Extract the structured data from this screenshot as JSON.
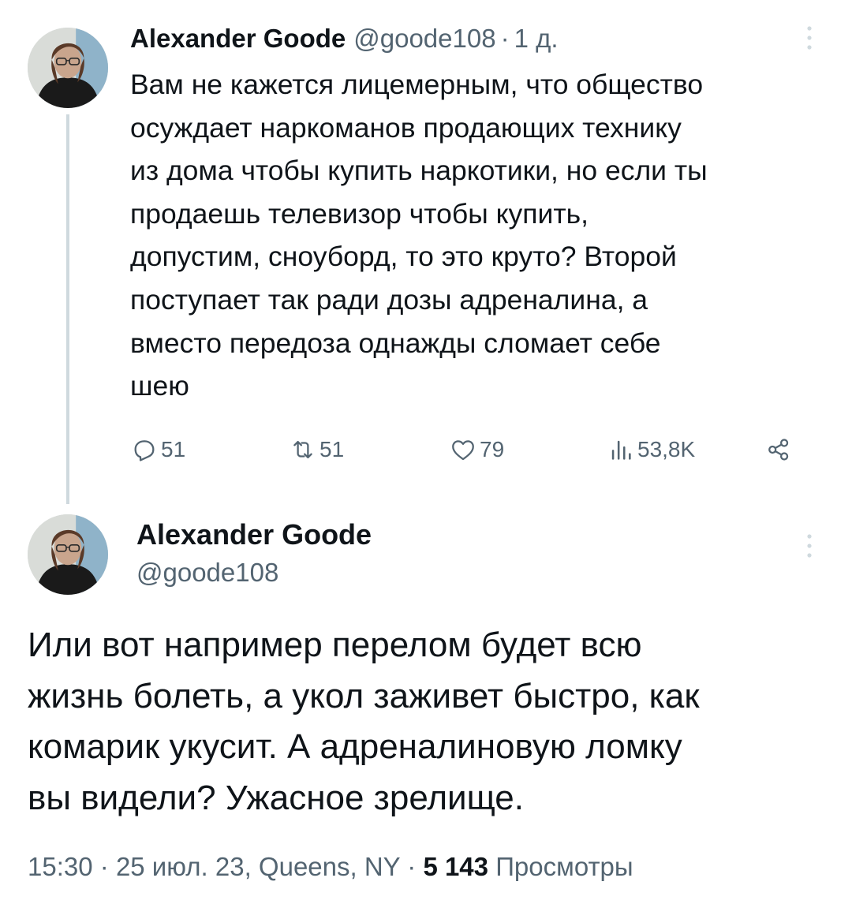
{
  "reply_tweet": {
    "author_name": "Alexander Goode",
    "handle": "@goode108",
    "separator": "·",
    "time": "1 д.",
    "text_lines": [
      "Вам не кажется лицемерным, что общество",
      "осуждает наркоманов продающих технику",
      "из дома чтобы купить наркотики, но если ты",
      "продаешь телевизор чтобы купить,",
      "допустим, сноуборд, то это круто? Второй",
      "поступает так ради дозы адреналина, а",
      "вместо передоза однажды сломает себе",
      "шею"
    ],
    "actions": {
      "replies": "51",
      "retweets": "51",
      "likes": "79",
      "views": "53,8K"
    }
  },
  "main_tweet": {
    "author_name": "Alexander Goode",
    "handle": "@goode108",
    "text_lines": [
      "Или вот например перелом будет всю",
      "жизнь болеть, а укол заживет быстро, как",
      "комарик укусит. А адреналиновую ломку",
      "вы видели? Ужасное зрелище."
    ],
    "meta": {
      "time": "15:30",
      "date": "25 июл. 23",
      "location": "Queens, NY",
      "separator": "·",
      "views_count": "5 143",
      "views_label": "Просмотры"
    }
  },
  "icons": [
    "avatar",
    "more-icon",
    "reply-icon",
    "retweet-icon",
    "like-icon",
    "views-icon",
    "share-icon"
  ],
  "colors": {
    "text": "#0f1419",
    "secondary": "#536471",
    "thread_line": "#cfd9de",
    "background": "#ffffff"
  }
}
